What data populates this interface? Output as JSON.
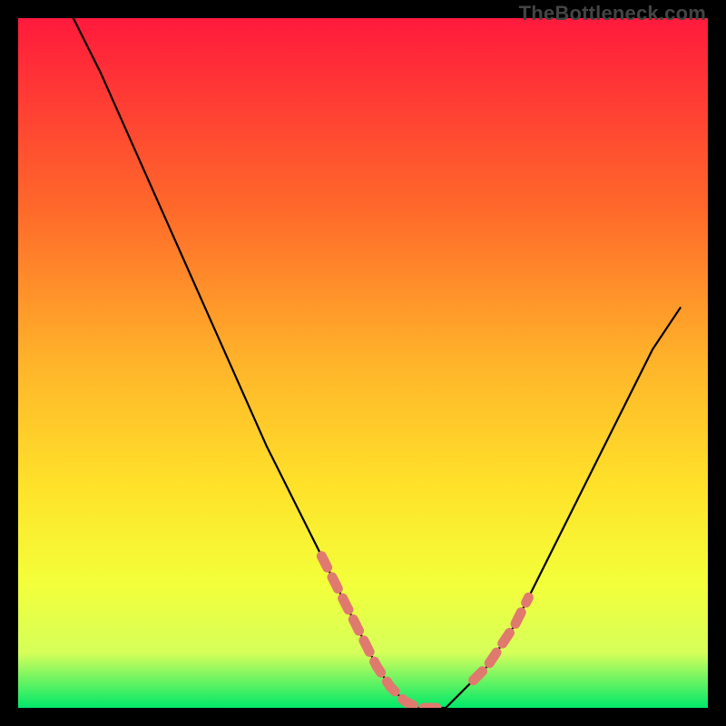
{
  "watermark": "TheBottleneck.com",
  "colors": {
    "gradient_top": "#ff1a3c",
    "gradient_mid1": "#ff6a2a",
    "gradient_mid2": "#ffb42a",
    "gradient_mid3": "#ffe22a",
    "gradient_mid4": "#f3ff3a",
    "gradient_low": "#d6ff5a",
    "gradient_green": "#00e86a",
    "curve_stroke": "#000000",
    "highlight_stroke": "#e07a6f",
    "frame_bg": "#000000"
  },
  "chart_data": {
    "type": "line",
    "title": "",
    "xlabel": "",
    "ylabel": "",
    "xlim": [
      0,
      100
    ],
    "ylim": [
      0,
      100
    ],
    "series": [
      {
        "name": "bottleneck-curve",
        "x": [
          8,
          12,
          16,
          20,
          24,
          28,
          32,
          36,
          40,
          44,
          48,
          50,
          52,
          54,
          56,
          58,
          60,
          62,
          64,
          68,
          72,
          76,
          80,
          84,
          88,
          92,
          96
        ],
        "values": [
          100,
          92,
          83,
          74,
          65,
          56,
          47,
          38,
          30,
          22,
          14,
          10,
          6,
          3,
          1,
          0,
          0,
          0,
          2,
          6,
          12,
          20,
          28,
          36,
          44,
          52,
          58
        ]
      }
    ],
    "highlight_segments": [
      {
        "name": "left-highlight",
        "x": [
          44,
          46,
          48,
          50,
          52,
          54,
          56,
          58,
          60,
          62
        ],
        "values": [
          22,
          18,
          14,
          10,
          6,
          3,
          1,
          0,
          0,
          0
        ]
      },
      {
        "name": "right-highlight",
        "x": [
          66,
          68,
          70,
          72,
          74
        ],
        "values": [
          4,
          6,
          9,
          12,
          16
        ]
      }
    ]
  }
}
